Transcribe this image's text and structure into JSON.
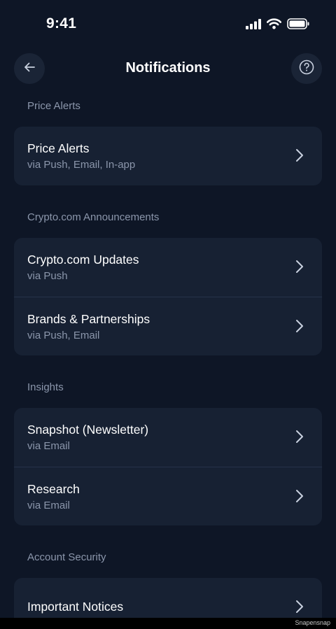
{
  "status_bar": {
    "time": "9:41",
    "icons": [
      "cellular-signal-icon",
      "wifi-icon",
      "battery-icon"
    ]
  },
  "header": {
    "title": "Notifications",
    "back_icon": "arrow-left-icon",
    "help_icon": "question-circle-icon"
  },
  "sections": [
    {
      "label": "Price Alerts",
      "items": [
        {
          "title": "Price Alerts",
          "subtitle": "via Push, Email, In-app"
        }
      ]
    },
    {
      "label": "Crypto.com Announcements",
      "items": [
        {
          "title": "Crypto.com Updates",
          "subtitle": "via Push"
        },
        {
          "title": "Brands & Partnerships",
          "subtitle": "via Push, Email"
        }
      ]
    },
    {
      "label": "Insights",
      "items": [
        {
          "title": "Snapshot (Newsletter)",
          "subtitle": "via Email"
        },
        {
          "title": "Research",
          "subtitle": "via Email"
        }
      ]
    },
    {
      "label": "Account Security",
      "items": [
        {
          "title": "Important Notices",
          "subtitle": ""
        }
      ]
    }
  ],
  "footer": {
    "watermark": "Snapensnap"
  },
  "colors": {
    "background": "#0e1626",
    "card": "#172133",
    "muted_text": "#8b96ab",
    "divider": "#26324a"
  }
}
